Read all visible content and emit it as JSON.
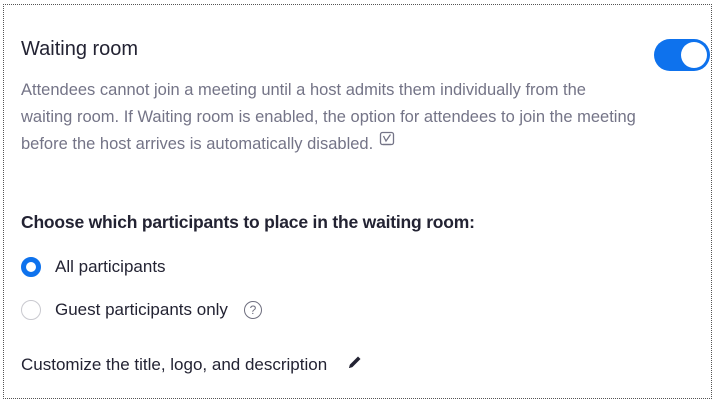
{
  "waiting_room": {
    "title": "Waiting room",
    "description": "Attendees cannot join a meeting until a host admits them individually from the waiting room. If Waiting room is enabled, the option for attendees to join the meeting before the host arrives is automatically disabled.",
    "toggle_on": true,
    "lock_icon": "locked-setting-icon"
  },
  "participants": {
    "heading": "Choose which participants to place in the waiting room:",
    "options": [
      {
        "label": "All participants",
        "selected": true
      },
      {
        "label": "Guest participants only",
        "selected": false,
        "help_icon": "question-circle-icon"
      }
    ]
  },
  "customize": {
    "label": "Customize the title, logo, and description",
    "icon": "pencil-icon"
  },
  "colors": {
    "accent": "#0e72ed",
    "text": "#232333",
    "muted": "#747487"
  }
}
